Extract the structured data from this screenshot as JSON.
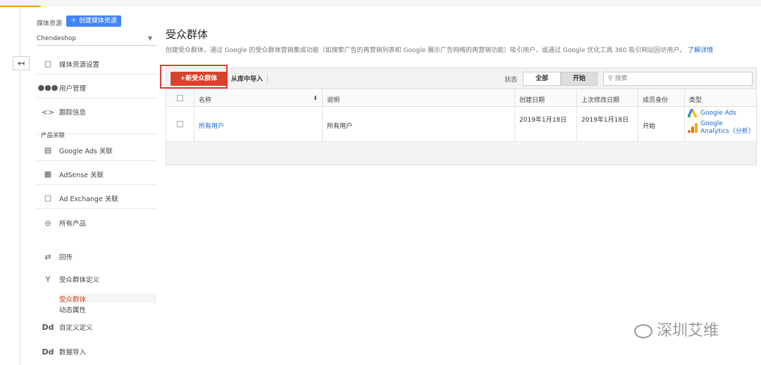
{
  "sidebar": {
    "resource_label": "媒体资源",
    "create_resource": "创建媒体资源",
    "account": "Chendeshop",
    "items": [
      {
        "label": "媒体资源设置",
        "icon": "window-icon"
      },
      {
        "label": "用户管理",
        "icon": "users-icon"
      },
      {
        "label": "跟踪信息",
        "icon": "code-icon"
      }
    ],
    "section_products": "产品关联",
    "product_items": [
      {
        "label": "Google Ads 关联"
      },
      {
        "label": "AdSense 关联"
      },
      {
        "label": "Ad Exchange 关联"
      },
      {
        "label": "所有产品"
      }
    ],
    "postback": "回传",
    "audience_def": "受众群体定义",
    "audience_sub": [
      "受众群体",
      "动态属性"
    ],
    "custom_def": "自定义定义",
    "data_import": "数据导入"
  },
  "page": {
    "title": "受众群体",
    "description": "创建受众群体，通过 Google 的受众群体营销集成功能（如搜索广告的再营销列表和 Google 展示广告网络的再营销功能）吸引用户，或通过 Google 优化工具 360 吸引网站回访用户。",
    "learn_more": "了解详情"
  },
  "toolbar": {
    "new_audience": "+新受众群体",
    "import": "从库中导入",
    "status_label": "状态",
    "filter_all": "全部",
    "filter_start": "开始",
    "search_placeholder": "搜索"
  },
  "table": {
    "headers": [
      "名称",
      "说明",
      "创建日期",
      "上次修改日期",
      "成员身份",
      "类型"
    ],
    "rows": [
      {
        "name": "所有用户",
        "desc": "所有用户",
        "created": "2019年1月18日",
        "modified": "2019年1月18日",
        "membership": "开始",
        "type1": "Google Ads",
        "type2": "Google Analytics（分析）"
      }
    ]
  },
  "watermark": "深圳艾维",
  "colors": {
    "accent_red": "#d6432b",
    "link_blue": "#1a66c7",
    "brand_blue": "#4285f4"
  }
}
